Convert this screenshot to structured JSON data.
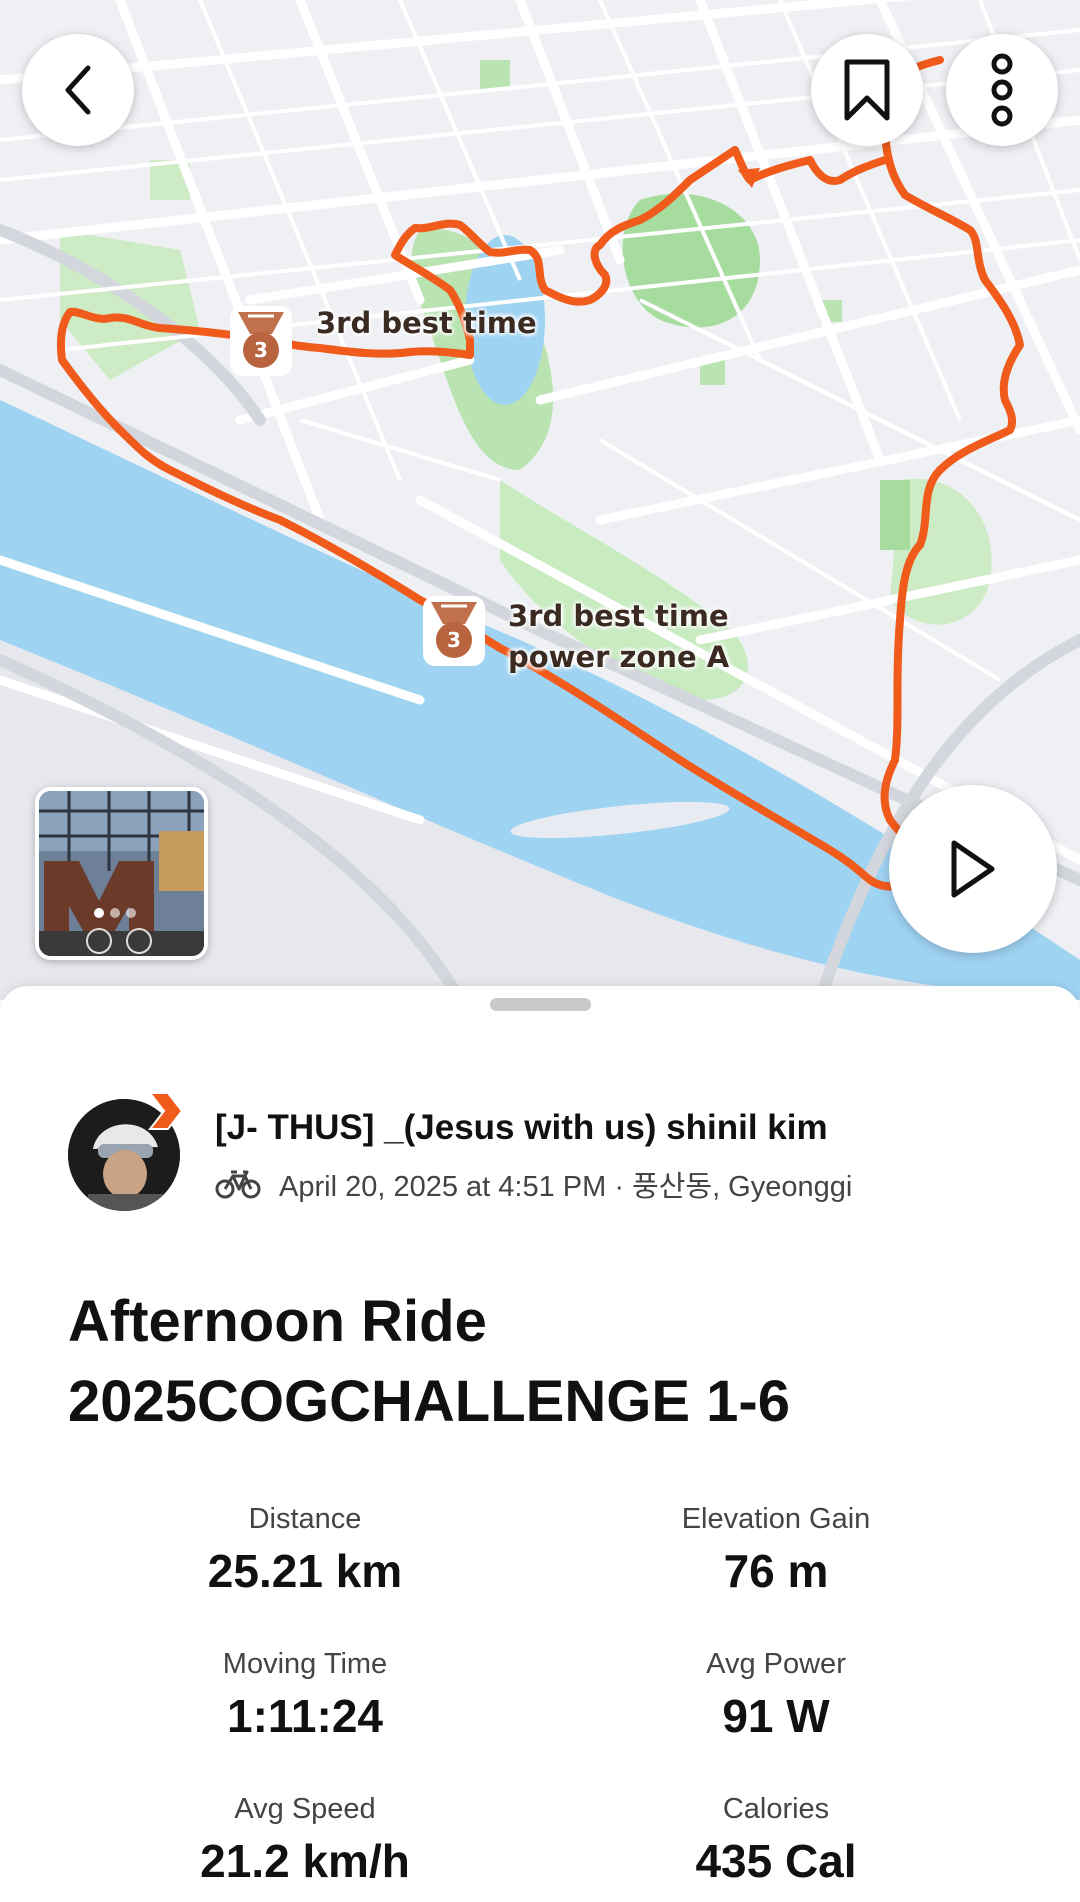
{
  "map": {
    "segments": [
      {
        "label_line1": "3rd best time",
        "label_line2": "",
        "medal_rank": "3"
      },
      {
        "label_line1": "3rd best time",
        "label_line2": "power zone A",
        "medal_rank": "3"
      }
    ],
    "route_color": "#f05a1a",
    "photo_pager": [
      "active",
      "inactive",
      "inactive"
    ]
  },
  "buttons": {
    "back_icon": "chevron-left-icon",
    "bookmark_icon": "bookmark-icon",
    "more_icon": "more-vertical-icon",
    "play_icon": "play-icon"
  },
  "athlete": {
    "name": "[J- THUS] _(Jesus with us) shinil kim",
    "activity_icon": "bike-icon",
    "meta": "April 20, 2025 at 4:51 PM · 풍산동, Gyeonggi"
  },
  "activity": {
    "title_line1": "Afternoon Ride",
    "title_line2": "2025COGCHALLENGE 1-6"
  },
  "stats": [
    {
      "label": "Distance",
      "value": "25.21 km"
    },
    {
      "label": "Elevation Gain",
      "value": "76 m"
    },
    {
      "label": "Moving Time",
      "value": "1:11:24"
    },
    {
      "label": "Avg Power",
      "value": "91 W"
    },
    {
      "label": "Avg Speed",
      "value": "21.2 km/h"
    },
    {
      "label": "Calories",
      "value": "435 Cal"
    }
  ]
}
